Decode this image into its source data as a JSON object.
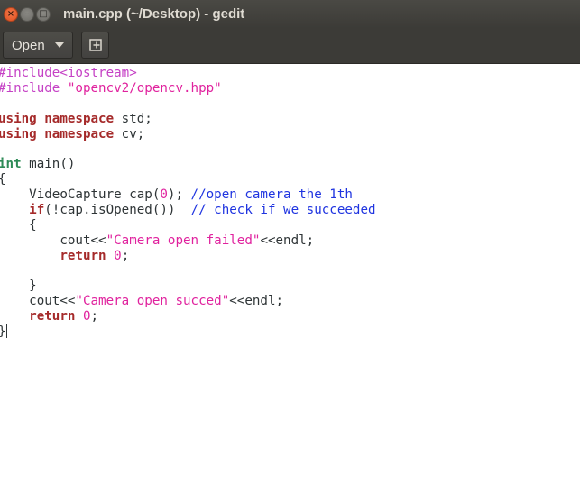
{
  "window": {
    "title": "main.cpp (~/Desktop) - gedit",
    "controls": {
      "close_glyph": "×",
      "minimize_glyph": "–",
      "maximize_glyph": "□"
    }
  },
  "toolbar": {
    "open_label": "Open",
    "new_tab_icon": "new-document-icon"
  },
  "editor": {
    "lines": [
      [
        {
          "t": "pp",
          "s": "#include<iostream>"
        }
      ],
      [
        {
          "t": "pp",
          "s": "#include "
        },
        {
          "t": "str",
          "s": "\"opencv2/opencv.hpp\""
        }
      ],
      [],
      [
        {
          "t": "kw",
          "s": "using"
        },
        {
          "t": "n",
          "s": " "
        },
        {
          "t": "kw",
          "s": "namespace"
        },
        {
          "t": "n",
          "s": " std;"
        }
      ],
      [
        {
          "t": "kw",
          "s": "using"
        },
        {
          "t": "n",
          "s": " "
        },
        {
          "t": "kw",
          "s": "namespace"
        },
        {
          "t": "n",
          "s": " cv;"
        }
      ],
      [],
      [
        {
          "t": "ty",
          "s": "int"
        },
        {
          "t": "n",
          "s": " main()"
        }
      ],
      [
        {
          "t": "n",
          "s": "{"
        }
      ],
      [
        {
          "t": "n",
          "s": "    VideoCapture cap("
        },
        {
          "t": "num",
          "s": "0"
        },
        {
          "t": "n",
          "s": "); "
        },
        {
          "t": "cm",
          "s": "//open camera the 1th"
        }
      ],
      [
        {
          "t": "n",
          "s": "    "
        },
        {
          "t": "kw",
          "s": "if"
        },
        {
          "t": "n",
          "s": "(!cap.isOpened())  "
        },
        {
          "t": "cm",
          "s": "// check if we succeeded"
        }
      ],
      [
        {
          "t": "n",
          "s": "    {"
        }
      ],
      [
        {
          "t": "n",
          "s": "        cout<<"
        },
        {
          "t": "str",
          "s": "\"Camera open failed\""
        },
        {
          "t": "n",
          "s": "<<endl;"
        }
      ],
      [
        {
          "t": "n",
          "s": "        "
        },
        {
          "t": "kw",
          "s": "return"
        },
        {
          "t": "n",
          "s": " "
        },
        {
          "t": "num",
          "s": "0"
        },
        {
          "t": "n",
          "s": ";"
        }
      ],
      [],
      [
        {
          "t": "n",
          "s": "    }"
        }
      ],
      [
        {
          "t": "n",
          "s": "    cout<<"
        },
        {
          "t": "str",
          "s": "\"Camera open succed\""
        },
        {
          "t": "n",
          "s": "<<endl;"
        }
      ],
      [
        {
          "t": "n",
          "s": "    "
        },
        {
          "t": "kw",
          "s": "return"
        },
        {
          "t": "n",
          "s": " "
        },
        {
          "t": "num",
          "s": "0"
        },
        {
          "t": "n",
          "s": ";"
        }
      ],
      [
        {
          "t": "n",
          "s": "}"
        }
      ]
    ],
    "cursor_line": 17
  },
  "colors": {
    "preprocessor": "#c541c5",
    "string": "#e0229e",
    "keyword": "#a52a2a",
    "type": "#2e8b57",
    "comment": "#1f34e0",
    "titlebar": "#3c3b37"
  }
}
